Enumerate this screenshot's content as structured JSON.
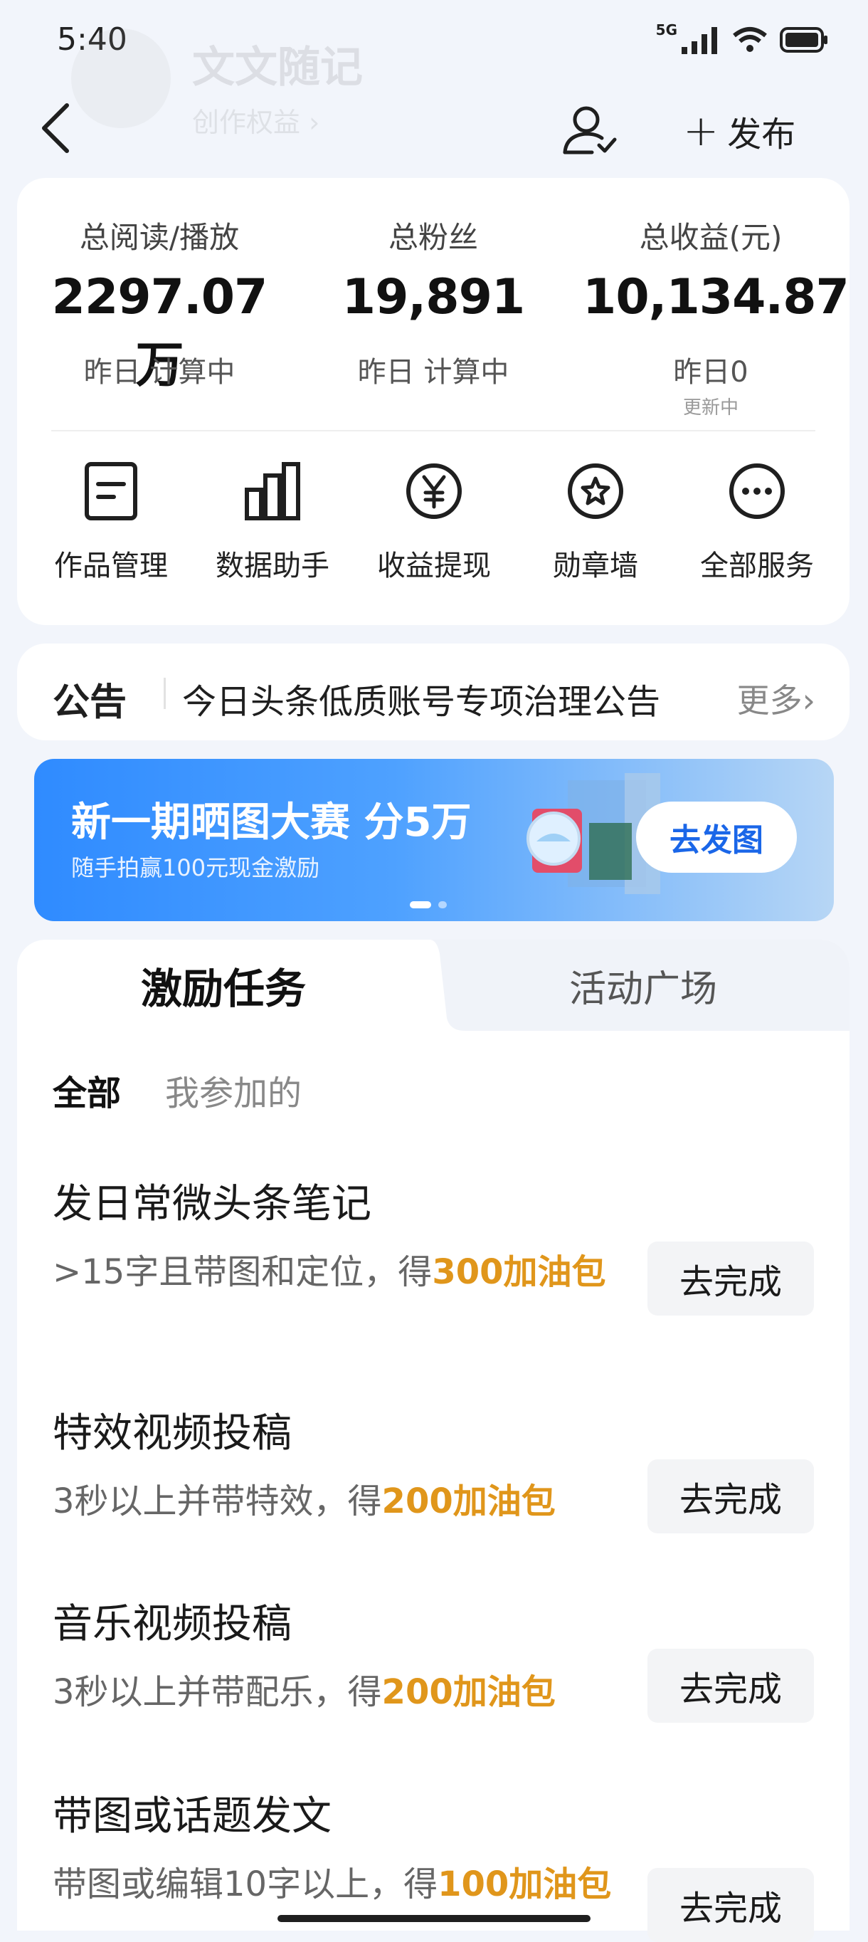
{
  "status_bar": {
    "time": "5:40",
    "network": "5G"
  },
  "header": {
    "name": "文文随记",
    "subtitle": "创作权益 ›",
    "publish_label": "发布"
  },
  "stats": [
    {
      "label": "总阅读/播放",
      "value": "2297.07万",
      "sub": "昨日 计算中",
      "sub2": ""
    },
    {
      "label": "总粉丝",
      "value": "19,891",
      "sub": "昨日 计算中",
      "sub2": ""
    },
    {
      "label": "总收益(元)",
      "value": "10,134.87",
      "sub": "昨日0",
      "sub2": "更新中"
    }
  ],
  "services": [
    {
      "label": "作品管理",
      "icon": "document-icon"
    },
    {
      "label": "数据助手",
      "icon": "bar-chart-icon"
    },
    {
      "label": "收益提现",
      "icon": "yen-icon"
    },
    {
      "label": "勋章墙",
      "icon": "badge-icon"
    },
    {
      "label": "全部服务",
      "icon": "more-icon"
    }
  ],
  "notice": {
    "label": "公告",
    "text": "今日头条低质账号专项治理公告",
    "more": "更多"
  },
  "banner": {
    "title": "新一期晒图大赛 分5万",
    "subtitle": "随手拍赢100元现金激励",
    "button": "去发图",
    "page_count": 2,
    "active_page": 1
  },
  "tabs": {
    "active": "激励任务",
    "inactive": "活动广场"
  },
  "filters": {
    "all": "全部",
    "mine": "我参加的"
  },
  "tasks": [
    {
      "title": "发日常微头条笔记",
      "desc": ">15字且带图和定位，得",
      "reward": "300加油包",
      "button": "去完成"
    },
    {
      "title": "特效视频投稿",
      "desc": "3秒以上并带特效，得",
      "reward": "200加油包",
      "button": "去完成"
    },
    {
      "title": "音乐视频投稿",
      "desc": "3秒以上并带配乐，得",
      "reward": "200加油包",
      "button": "去完成"
    },
    {
      "title": "带图或话题发文",
      "desc": "带图或编辑10字以上，得",
      "reward": "100加油包",
      "button": "去完成"
    }
  ],
  "colors": {
    "accent_blue": "#1a66e8",
    "reward_orange": "#e0961b",
    "background": "#f2f5fb"
  }
}
